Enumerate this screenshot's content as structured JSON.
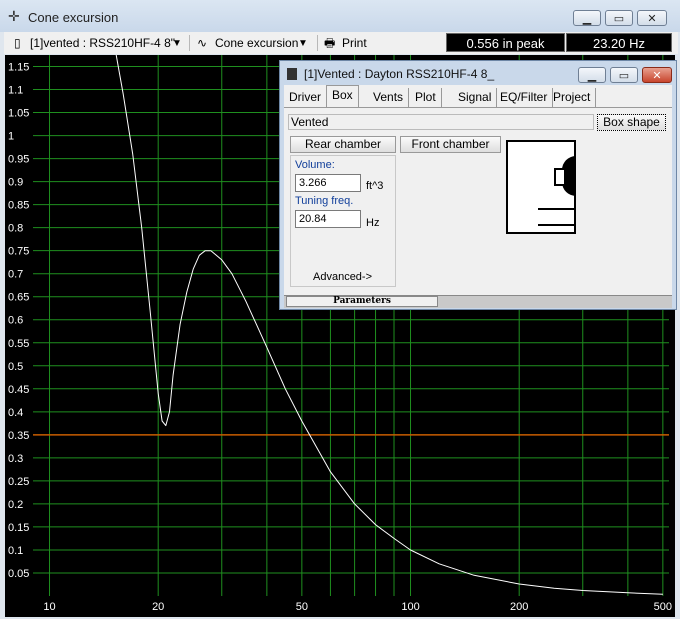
{
  "window": {
    "title": "Cone excursion"
  },
  "toolbar": {
    "driver_select": "[1]vented : RSS210HF-4 8\"",
    "graph_select": "Cone excursion",
    "print_label": "Print",
    "readout_peak": "0.556 in peak",
    "readout_freq": "23.20 Hz"
  },
  "dialog": {
    "title": "[1]Vented : Dayton RSS210HF-4 8_",
    "tabs": [
      "Driver",
      "Box",
      "Vents",
      "Plot",
      "Signal",
      "EQ/Filter",
      "Project"
    ],
    "active_tab": "Box",
    "box_type": "Vented",
    "box_shape_button": "Box shape",
    "rear_chamber_button": "Rear chamber",
    "front_chamber_button": "Front chamber",
    "volume_label": "Volume:",
    "volume_value": "3.266",
    "volume_unit": "ft^3",
    "tuning_label": "Tuning freq.",
    "tuning_value": "20.84",
    "tuning_unit": "Hz",
    "advanced_button": "Advanced->",
    "status_left": "Parameters"
  },
  "colors": {
    "grid": "#1f8f1f",
    "curve": "#ffffff",
    "xmax_line": "#c85a00",
    "plot_bg": "#000000"
  },
  "chart_data": {
    "type": "line",
    "x_scale": "log",
    "xlim": [
      9,
      520
    ],
    "ylim": [
      0,
      1.175
    ],
    "x_tick_labels": [
      "10",
      "20",
      "50",
      "100",
      "200",
      "500"
    ],
    "x_ticks": [
      10,
      20,
      50,
      100,
      200,
      500
    ],
    "y_tick_labels": [
      "1.15",
      "1.1",
      "1.05",
      "1",
      "0.95",
      "0.9",
      "0.85",
      "0.8",
      "0.75",
      "0.7",
      "0.65",
      "0.6",
      "0.55",
      "0.5",
      "0.45",
      "0.4",
      "0.35",
      "0.3",
      "0.25",
      "0.2",
      "0.15",
      "0.1",
      "0.05"
    ],
    "y_ticks": [
      1.15,
      1.1,
      1.05,
      1,
      0.95,
      0.9,
      0.85,
      0.8,
      0.75,
      0.7,
      0.65,
      0.6,
      0.55,
      0.5,
      0.45,
      0.4,
      0.35,
      0.3,
      0.25,
      0.2,
      0.15,
      0.1,
      0.05
    ],
    "reference_line_y": 0.35,
    "series": [
      {
        "x": [
          15.3,
          16,
          17,
          18,
          19,
          20,
          20.5,
          21,
          21.5,
          22,
          23,
          24,
          25,
          26,
          27,
          28,
          30,
          32,
          35,
          40,
          45,
          50,
          60,
          70,
          80,
          90,
          100,
          120,
          150,
          200,
          250,
          300,
          400,
          500
        ],
        "y": [
          1.175,
          1.09,
          0.96,
          0.8,
          0.62,
          0.44,
          0.38,
          0.37,
          0.4,
          0.48,
          0.59,
          0.66,
          0.71,
          0.74,
          0.75,
          0.75,
          0.73,
          0.7,
          0.64,
          0.54,
          0.45,
          0.38,
          0.27,
          0.2,
          0.155,
          0.125,
          0.1,
          0.07,
          0.045,
          0.026,
          0.017,
          0.012,
          0.007,
          0.004
        ]
      }
    ]
  }
}
